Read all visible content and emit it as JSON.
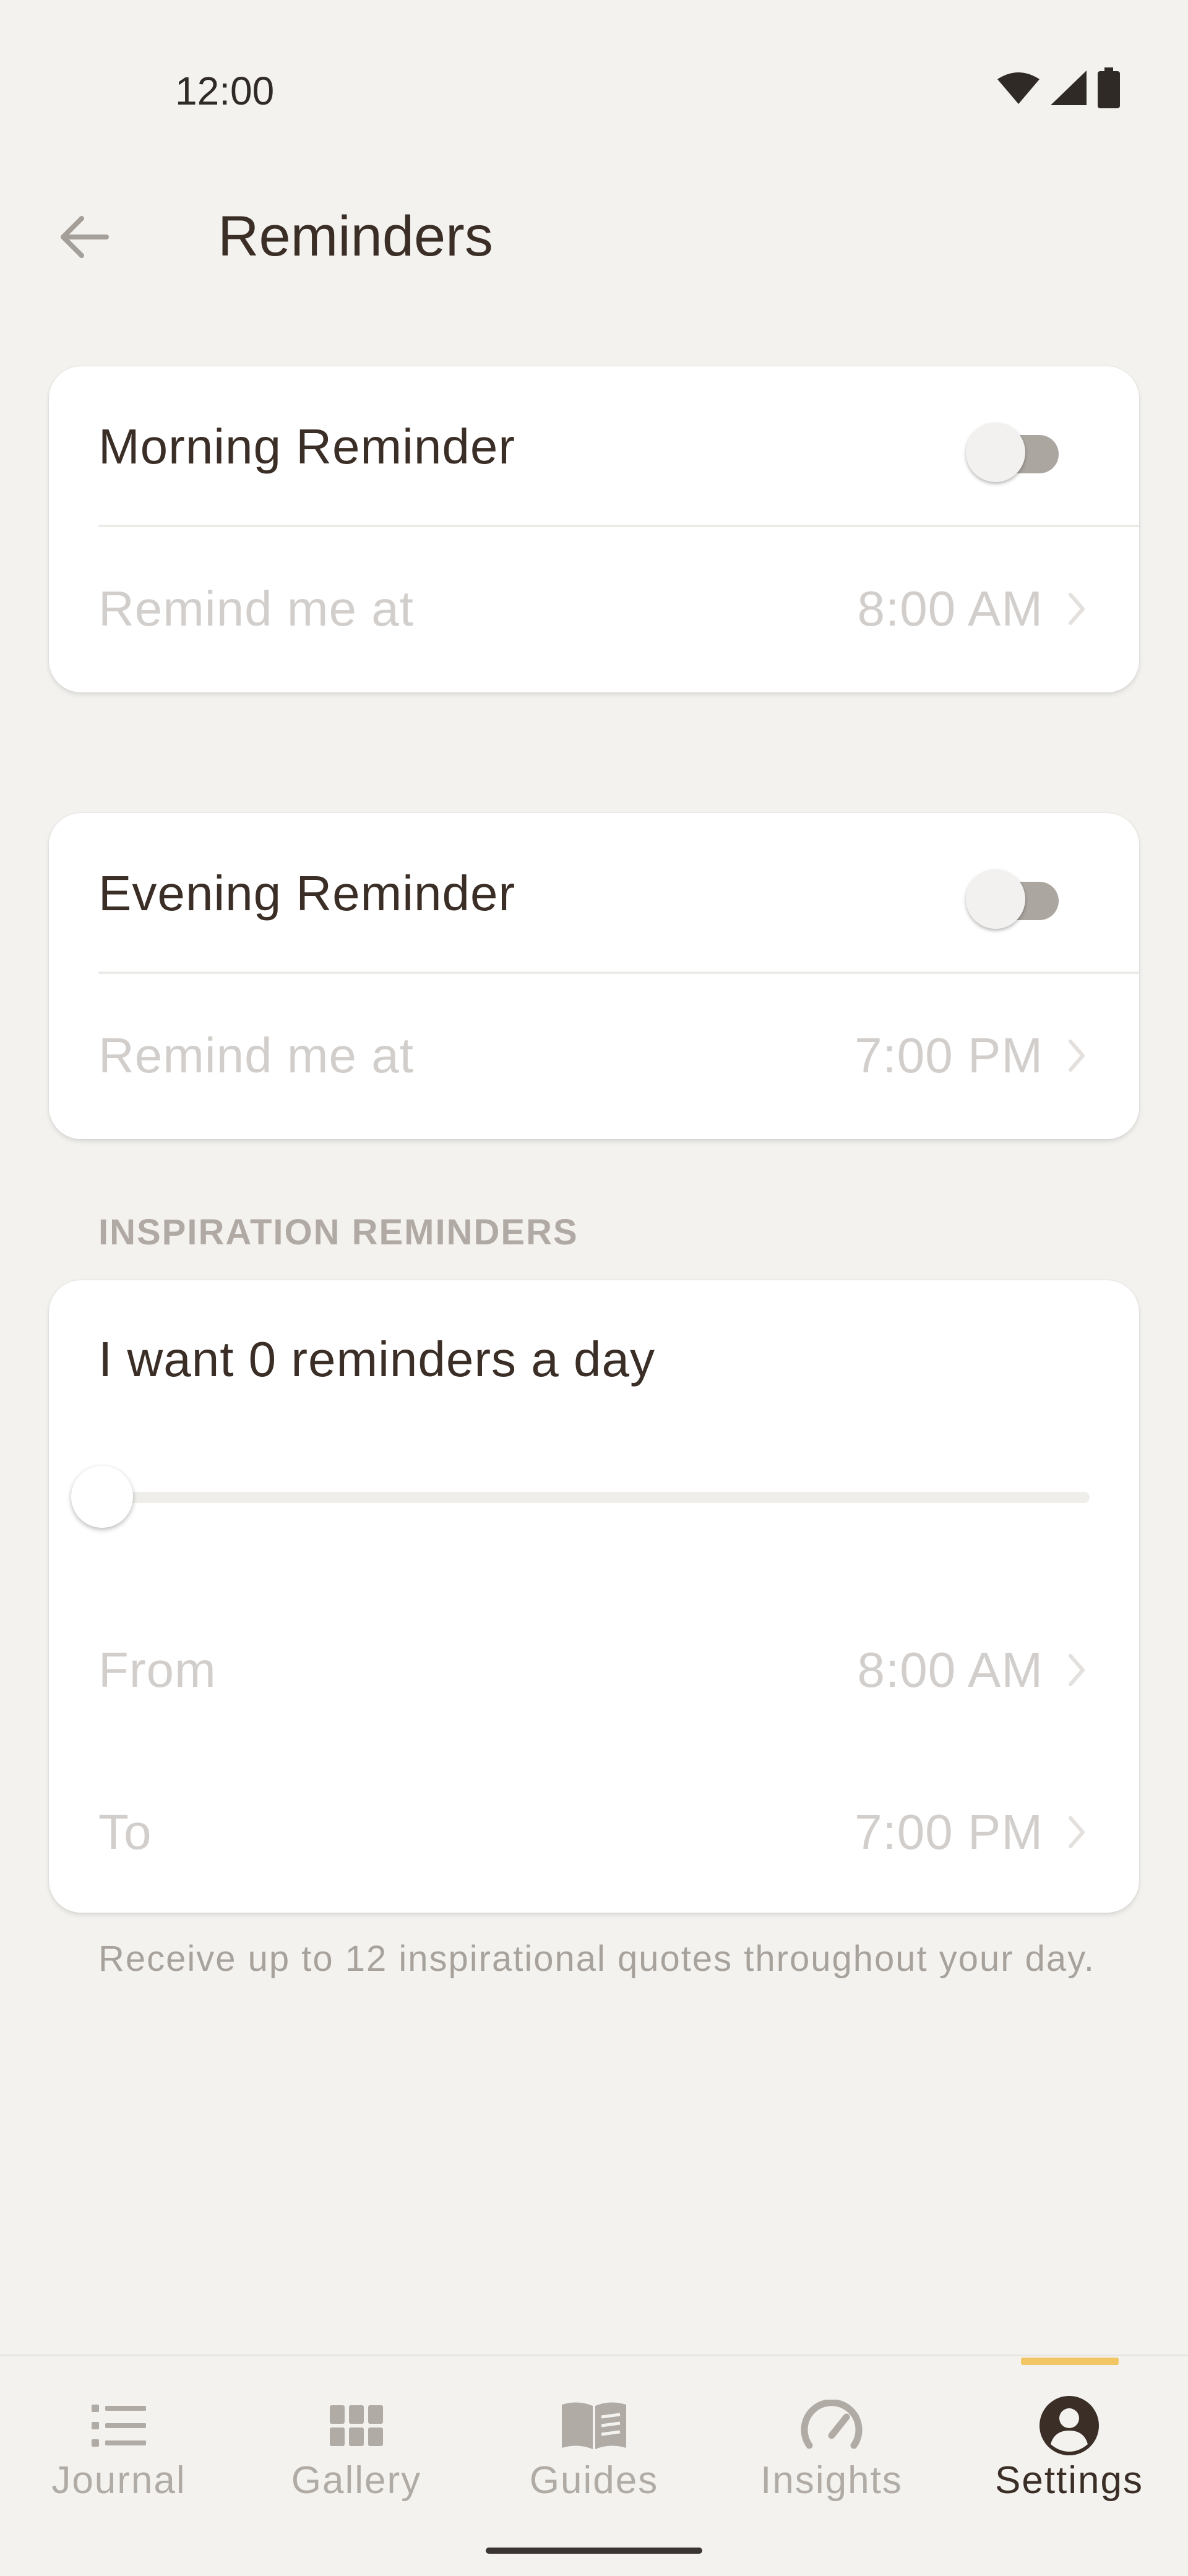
{
  "status_bar": {
    "time": "12:00",
    "icons": [
      "wifi-icon",
      "signal-icon",
      "battery-icon"
    ]
  },
  "header": {
    "title": "Reminders",
    "back_icon": "arrow-left-icon"
  },
  "morning": {
    "title": "Morning Reminder",
    "enabled": false,
    "label": "Remind me at",
    "time": "8:00 AM"
  },
  "evening": {
    "title": "Evening Reminder",
    "enabled": false,
    "label": "Remind me at",
    "time": "7:00 PM"
  },
  "inspiration": {
    "section_title": "INSPIRATION REMINDERS",
    "count_text": "I want 0 reminders a day",
    "slider_value": 0,
    "slider_max": 12,
    "from_label": "From",
    "from_time": "8:00 AM",
    "to_label": "To",
    "to_time": "7:00 PM",
    "helper_text": "Receive up to 12 inspirational quotes throughout your day."
  },
  "nav": {
    "active": "Settings",
    "items": [
      {
        "label": "Journal",
        "icon": "list-icon"
      },
      {
        "label": "Gallery",
        "icon": "grid-icon"
      },
      {
        "label": "Guides",
        "icon": "book-icon"
      },
      {
        "label": "Insights",
        "icon": "gauge-icon"
      },
      {
        "label": "Settings",
        "icon": "account-circle-icon"
      }
    ]
  },
  "colors": {
    "background": "#f3f2ef",
    "text": "#3a2e26",
    "muted": "#d2cecb",
    "accent": "#f2c665",
    "toggle_off": "#aba6a0"
  }
}
